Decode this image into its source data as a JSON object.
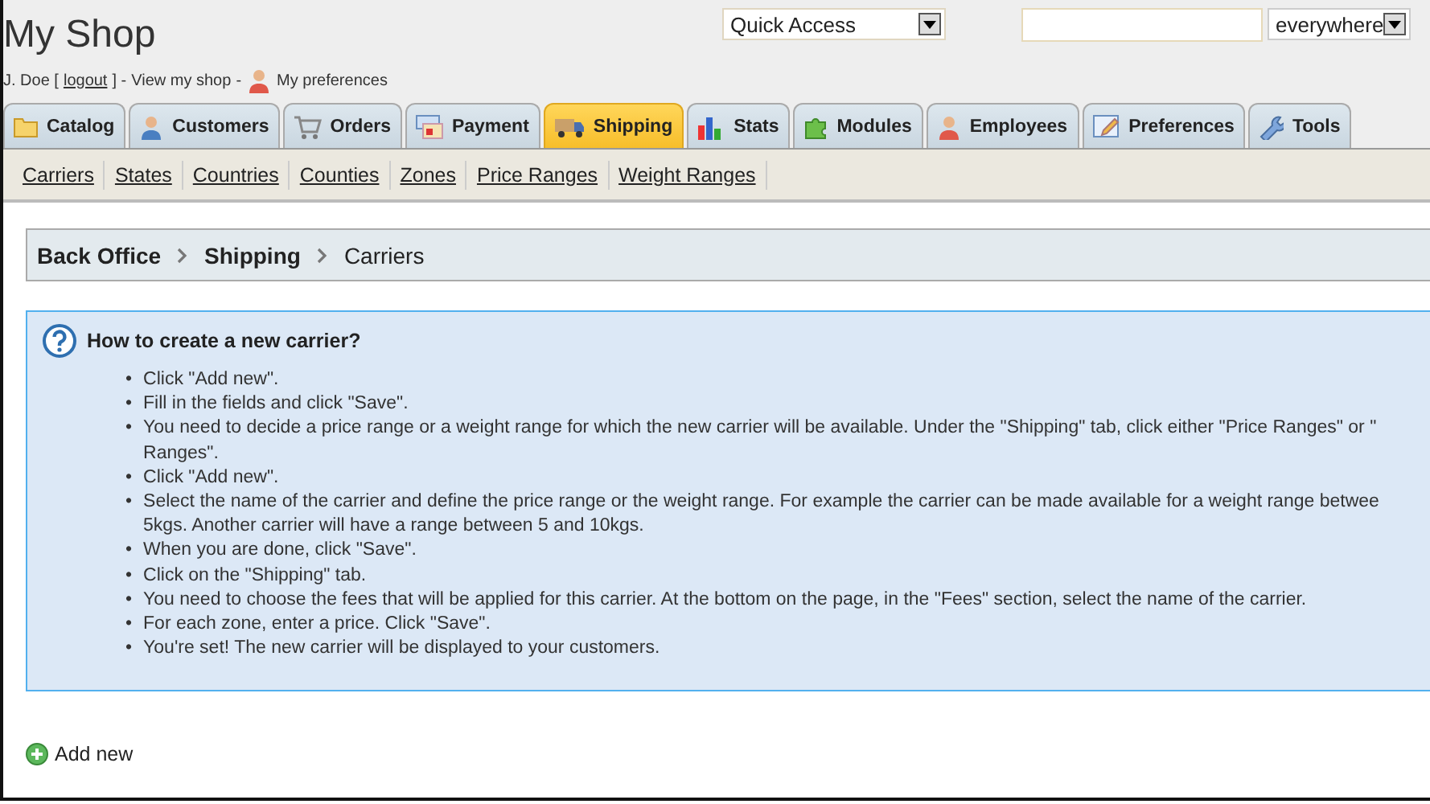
{
  "header": {
    "title": "My Shop",
    "user": "J. Doe [",
    "logout": "logout",
    "after_logout": "] -",
    "view_shop": "View my shop",
    "dash": "-",
    "preferences": "My preferences",
    "quick_access": "Quick Access",
    "search_scope": "everywhere"
  },
  "tabs": [
    {
      "label": "Catalog",
      "selected": false
    },
    {
      "label": "Customers",
      "selected": false
    },
    {
      "label": "Orders",
      "selected": false
    },
    {
      "label": "Payment",
      "selected": false
    },
    {
      "label": "Shipping",
      "selected": true
    },
    {
      "label": "Stats",
      "selected": false
    },
    {
      "label": "Modules",
      "selected": false
    },
    {
      "label": "Employees",
      "selected": false
    },
    {
      "label": "Preferences",
      "selected": false
    },
    {
      "label": "Tools",
      "selected": false
    }
  ],
  "subnav": [
    "Carriers",
    "States",
    "Countries",
    "Counties",
    "Zones",
    "Price Ranges",
    "Weight Ranges"
  ],
  "breadcrumb": [
    "Back Office",
    "Shipping",
    "Carriers"
  ],
  "help": {
    "title": "How to create a new carrier?",
    "bullet": "•",
    "steps": [
      "Click \"Add new\".",
      "Fill in the fields and click \"Save\".",
      "You need to decide a price range or a weight range for which the new carrier will be available. Under the \"Shipping\" tab, click either \"Price Ranges\" or \"\nRanges\".",
      "Click \"Add new\".",
      "Select the name of the carrier and define the price range or the weight range. For example the carrier can be made available for a weight range betwee\n5kgs. Another carrier will have a range between 5 and 10kgs.",
      "When you are done, click \"Save\".",
      "Click on the \"Shipping\" tab.",
      "You need to choose the fees that will be applied for this carrier. At the bottom on the page, in the \"Fees\" section, select the name of the carrier.",
      "For each zone, enter a price. Click \"Save\".",
      "You're set! The new carrier will be displayed to your customers."
    ]
  },
  "add_new": "Add new"
}
